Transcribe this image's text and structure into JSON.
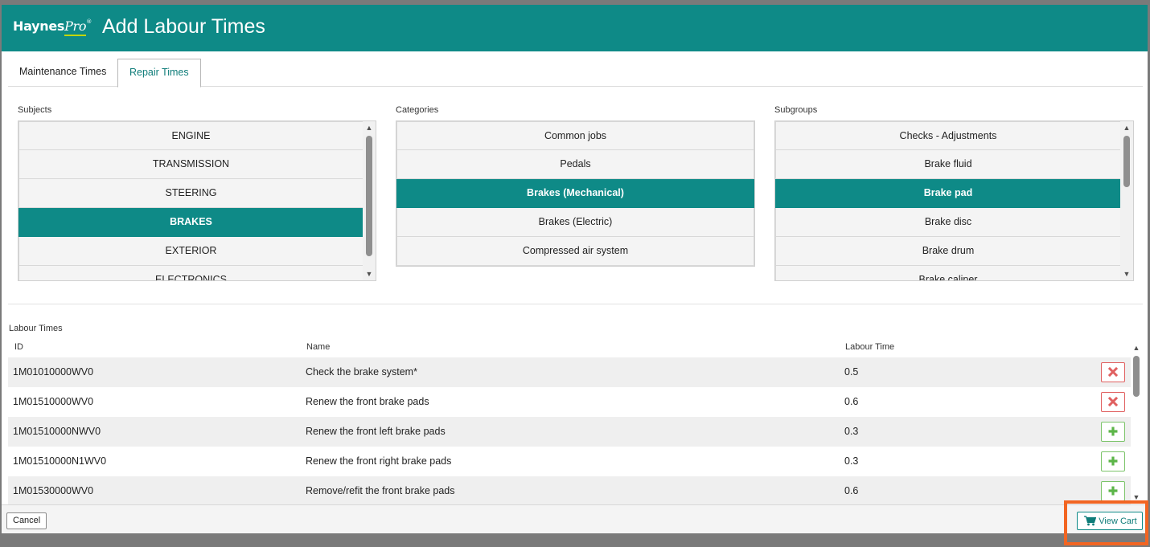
{
  "header": {
    "logo_main": "Haynes",
    "logo_pro": "Pro",
    "logo_reg": "®",
    "title": "Add Labour Times"
  },
  "tabs": [
    {
      "label": "Maintenance Times",
      "active": false
    },
    {
      "label": "Repair Times",
      "active": true
    }
  ],
  "subjects": {
    "label": "Subjects",
    "items": [
      "ENGINE",
      "TRANSMISSION",
      "STEERING",
      "BRAKES",
      "EXTERIOR",
      "ELECTRONICS"
    ],
    "selected": "BRAKES"
  },
  "categories": {
    "label": "Categories",
    "items": [
      "Common jobs",
      "Pedals",
      "Brakes (Mechanical)",
      "Brakes (Electric)",
      "Compressed air system"
    ],
    "selected": "Brakes (Mechanical)"
  },
  "subgroups": {
    "label": "Subgroups",
    "items": [
      "Checks - Adjustments",
      "Brake fluid",
      "Brake pad",
      "Brake disc",
      "Brake drum",
      "Brake caliper"
    ],
    "selected": "Brake pad"
  },
  "labour_times": {
    "label": "Labour Times",
    "columns": {
      "id": "ID",
      "name": "Name",
      "time": "Labour Time"
    },
    "rows": [
      {
        "id": "1M01010000WV0",
        "name": "Check the brake system*",
        "time": "0.5",
        "action": "remove"
      },
      {
        "id": "1M01510000WV0",
        "name": "Renew the front brake pads",
        "time": "0.6",
        "action": "remove"
      },
      {
        "id": "1M01510000NWV0",
        "name": "Renew the front left brake pads",
        "time": "0.3",
        "action": "add"
      },
      {
        "id": "1M01510000N1WV0",
        "name": "Renew the front right brake pads",
        "time": "0.3",
        "action": "add"
      },
      {
        "id": "1M01530000WV0",
        "name": "Remove/refit the front brake pads",
        "time": "0.6",
        "action": "add"
      }
    ]
  },
  "footer": {
    "cancel_label": "Cancel",
    "cart_label": "View Cart"
  },
  "colors": {
    "brand": "#0e8a87",
    "remove": "#e06060",
    "add": "#5cb548",
    "highlight": "#f26522"
  }
}
